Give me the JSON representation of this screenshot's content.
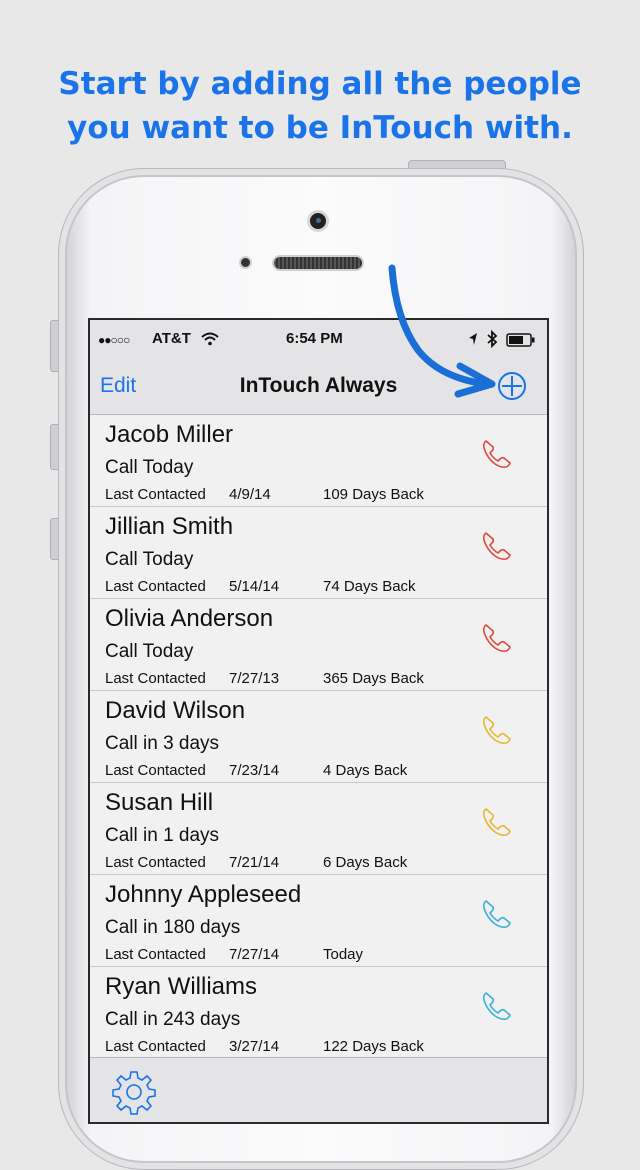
{
  "headline": {
    "line1": "Start by adding all the people",
    "line2": "you want to be InTouch with."
  },
  "status_bar": {
    "signal": "●●○○○",
    "carrier": "AT&T",
    "time": "6:54 PM"
  },
  "nav": {
    "edit_label": "Edit",
    "title": "InTouch Always",
    "add_icon": "plus-circle-icon"
  },
  "contacts": [
    {
      "name": "Jacob Miller",
      "due": "Call Today",
      "last_label": "Last Contacted",
      "date": "4/9/14",
      "days": "109 Days Back",
      "color": "#e04b3a"
    },
    {
      "name": "Jillian Smith",
      "due": "Call Today",
      "last_label": "Last Contacted",
      "date": "5/14/14",
      "days": "74 Days Back",
      "color": "#e04b3a"
    },
    {
      "name": "Olivia Anderson",
      "due": "Call Today",
      "last_label": "Last Contacted",
      "date": "7/27/13",
      "days": "365 Days Back",
      "color": "#e04b3a"
    },
    {
      "name": "David Wilson",
      "due": "Call in 3 days",
      "last_label": "Last Contacted",
      "date": "7/23/14",
      "days": "4 Days Back",
      "color": "#e8b62e"
    },
    {
      "name": "Susan Hill",
      "due": "Call in 1 days",
      "last_label": "Last Contacted",
      "date": "7/21/14",
      "days": "6 Days Back",
      "color": "#e8b62e"
    },
    {
      "name": "Johnny Appleseed",
      "due": "Call in 180 days",
      "last_label": "Last Contacted",
      "date": "7/27/14",
      "days": "Today",
      "color": "#3bb0d9"
    },
    {
      "name": "Ryan Williams",
      "due": "Call in 243 days",
      "last_label": "Last Contacted",
      "date": "3/27/14",
      "days": "122 Days Back",
      "color": "#3bb0d9"
    }
  ],
  "toolbar": {
    "settings_icon": "gear-icon"
  },
  "colors": {
    "accent": "#1a73e8"
  }
}
